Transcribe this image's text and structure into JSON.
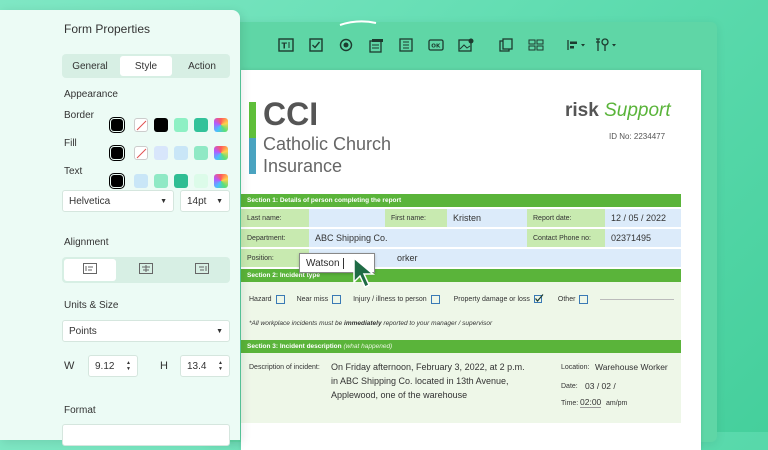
{
  "panel": {
    "title": "Form Properties",
    "tabs": [
      "General",
      "Style",
      "Action"
    ],
    "active_tab": "Style",
    "appearance": "Appearance",
    "border_label": "Border",
    "fill_label": "Fill",
    "text_label": "Text",
    "font": "Helvetica",
    "font_size": "14pt",
    "alignment": "Alignment",
    "units_size": "Units & Size",
    "units": "Points",
    "w_label": "W",
    "w_value": "9.12",
    "h_label": "H",
    "h_value": "13.4",
    "format": "Format"
  },
  "colors": {
    "border_swatches": [
      "#000000",
      "#ffffff",
      "#000000",
      "#8ef0c4",
      "#33c29a",
      "rainbow"
    ],
    "fill_swatches": [
      "#000000",
      "#ffffff",
      "#d8e6fb",
      "#c9e6f7",
      "#8fe9c5",
      "rainbow"
    ],
    "text_swatches": [
      "#000000",
      "#c9e6f7",
      "#8fe9c5",
      "#2fbd93",
      "#dcfbe9",
      "rainbow"
    ],
    "accent": "#5ab43a"
  },
  "doc": {
    "logo_big": "CCI",
    "logo_line1": "Catholic Church",
    "logo_line2": "Insurance",
    "brand_risk": "risk",
    "brand_support": "Support",
    "id_no": "ID No: 2234477",
    "section1": "Section 1: Details of person completing the report",
    "last_name_label": "Last name:",
    "last_name_value": "Watson",
    "first_name_label": "First name:",
    "first_name_value": "Kristen",
    "report_date_label": "Report date:",
    "report_date_value": "12 / 05 / 2022",
    "department_label": "Department:",
    "department_value": "ABC Shipping Co.",
    "contact_label": "Contact Phone no:",
    "contact_value": "02371495",
    "position_label": "Position:",
    "position_value": "orker",
    "section2": "Section 2: Incident type",
    "hazard": "Hazard",
    "near_miss": "Near miss",
    "injury": "Injury / illness to person",
    "property": "Property damage or loss",
    "other": "Other",
    "note_pre": "*All workplace incidents must be ",
    "note_bold": "immediately",
    "note_post": " reported to your manager / supervisor",
    "section3": "Section 3: Incident description",
    "section3_hint": "(what happened)",
    "desc_label": "Description of incident:",
    "desc_line1": "On Friday afternoon, February 3, 2022, at 2 p.m.",
    "desc_line2": "in ABC Shipping Co. located in 13th Avenue,",
    "desc_line3": "Applewood, one of the warehouse",
    "location_label": "Location:",
    "location_value": "Warehouse Worker",
    "date_label": "Date:",
    "date_value": "03 / 02 /",
    "time_label": "Time:",
    "time_value": "02:00",
    "time_unit": "am/pm"
  }
}
